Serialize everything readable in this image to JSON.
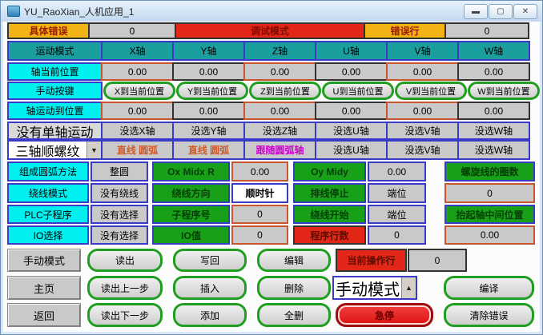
{
  "window": {
    "title": "YU_RaoXian_人机应用_1"
  },
  "titlebar_icons": {
    "minimize": "▬",
    "maximize": "▢",
    "close": "✕"
  },
  "colors": {
    "teal": "#1a9e9e",
    "cyan": "#00efef",
    "green": "#18a018",
    "red": "#e22618",
    "yellow": "#f2b414",
    "gray": "#c9c9c9",
    "pill_border": "#1f9e1f",
    "border_blue": "#3a3ac8",
    "border_red": "#c8552d"
  },
  "status_row": {
    "label": "具体错误",
    "value": "0",
    "mode": "调试模式",
    "err_line_label": "错误行",
    "err_line_value": "0"
  },
  "axes": {
    "label": "运动模式",
    "headers": [
      "X轴",
      "Y轴",
      "Z轴",
      "U轴",
      "V轴",
      "W轴"
    ]
  },
  "current_pos": {
    "label": "轴当前位置",
    "values": [
      "0.00",
      "0.00",
      "0.00",
      "0.00",
      "0.00",
      "0.00"
    ]
  },
  "manual_keys": {
    "label": "手动按键",
    "buttons": [
      "X到当前位置",
      "Y到当前位置",
      "Z到当前位置",
      "U到当前位置",
      "V到当前位置",
      "W到当前位置"
    ]
  },
  "move_to": {
    "label": "轴运动到位置",
    "values": [
      "0.00",
      "0.00",
      "0.00",
      "0.00",
      "0.00",
      "0.00"
    ]
  },
  "single_axis": {
    "label": "没有单轴运动",
    "cells": [
      "没选X轴",
      "没选Y轴",
      "没选Z轴",
      "没选U轴",
      "没选V轴",
      "没选W轴"
    ]
  },
  "thread_mode": {
    "selected": "三轴顺螺纹",
    "dropdown_icon": "▼",
    "cells": [
      "直线 圆弧",
      "直线 圆弧",
      "跟随圆弧轴",
      "没选U轴",
      "没选V轴",
      "没选W轴"
    ]
  },
  "arc_row": {
    "label": "组成圆弧方法",
    "v1": "整圆",
    "k2": "Ox Midx R",
    "v2": "0.00",
    "k3": "Oy Midy",
    "v3": "0.00",
    "k4": "螺旋线的圈数"
  },
  "wind_row": {
    "label": "绕线模式",
    "v1": "没有绕线",
    "k2": "绕线方向",
    "v2": "顺时针",
    "k3": "排线停止",
    "v3": "端位",
    "v4": "0"
  },
  "plc_row": {
    "label": "PLC子程序",
    "v1": "没有选择",
    "k2": "子程序号",
    "v2": "0",
    "k3": "绕线开始",
    "v3": "端位",
    "k4": "抬起轴中间位置"
  },
  "io_row": {
    "label": "IO选择",
    "v1": "没有选择",
    "k2": "IO值",
    "v2": "0",
    "k3": "程序行数",
    "v3": "0",
    "v4": "0.00"
  },
  "bottom": {
    "nav": [
      "手动模式",
      "主页",
      "返回"
    ],
    "r1": {
      "b1": "读出",
      "b2": "写回",
      "b3": "编辑",
      "cur_label": "当前操作行",
      "cur_value": "0"
    },
    "r2": {
      "b1": "读出上一步",
      "b2": "插入",
      "b3": "删除",
      "mode_selected": "手动模式",
      "dropup_icon": "▲",
      "b4": "编译"
    },
    "r3": {
      "b1": "读出下一步",
      "b2": "添加",
      "b3": "全删",
      "estop": "急停",
      "b4": "清除错误"
    }
  }
}
